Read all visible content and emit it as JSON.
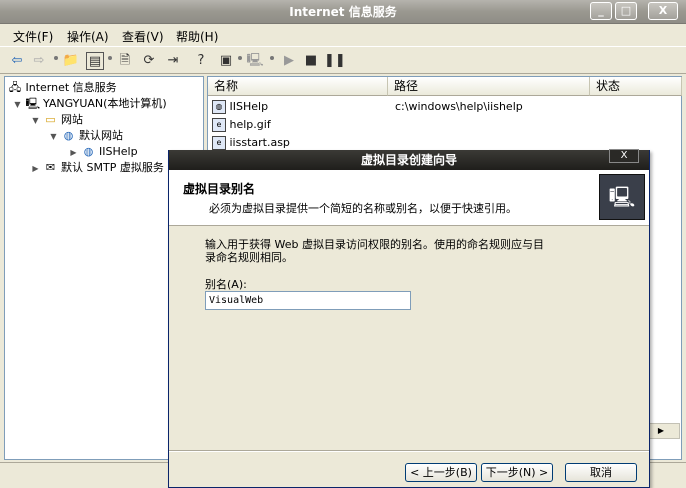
{
  "window": {
    "title": "Internet 信息服务",
    "min_label": "_",
    "max_label": "□",
    "close_label": "X"
  },
  "menu": [
    "文件(F)",
    "操作(A)",
    "查看(V)",
    "帮助(H)"
  ],
  "toolbar": {
    "icons": [
      "back-arrow-icon",
      "forward-arrow-icon",
      "up-folder-icon",
      "show-tree-icon",
      "properties-icon",
      "refresh-icon",
      "export-icon",
      "help-icon",
      "console-icon",
      "computer-icon",
      "play-icon",
      "stop-icon",
      "pause-icon"
    ]
  },
  "tree": {
    "root": "Internet 信息服务",
    "computer": "YANGYUAN(本地计算机)",
    "websites": "网站",
    "default_site": "默认网站",
    "iishelp": "IISHelp",
    "smtp": "默认 SMTP 虚拟服务"
  },
  "list": {
    "columns": [
      "名称",
      "路径",
      "状态"
    ],
    "rows": [
      {
        "name": "IISHelp",
        "path": "c:\\windows\\help\\iishelp"
      },
      {
        "name": "help.gif",
        "path": ""
      },
      {
        "name": "iisstart.asp",
        "path": ""
      }
    ]
  },
  "wizard": {
    "title": "虚拟目录创建向导",
    "close_label": "X",
    "heading": "虚拟目录别名",
    "subheading": "必须为虚拟目录提供一个简短的名称或别名，以便于快速引用。",
    "description": "输入用于获得 Web 虚拟目录访问权限的别名。使用的命名规则应与目录命名规则相同。",
    "alias_label": "别名(A):",
    "alias_value": "VisualWeb",
    "back_button": "< 上一步(B)",
    "next_button": "下一步(N) >",
    "cancel_button": "取消"
  }
}
